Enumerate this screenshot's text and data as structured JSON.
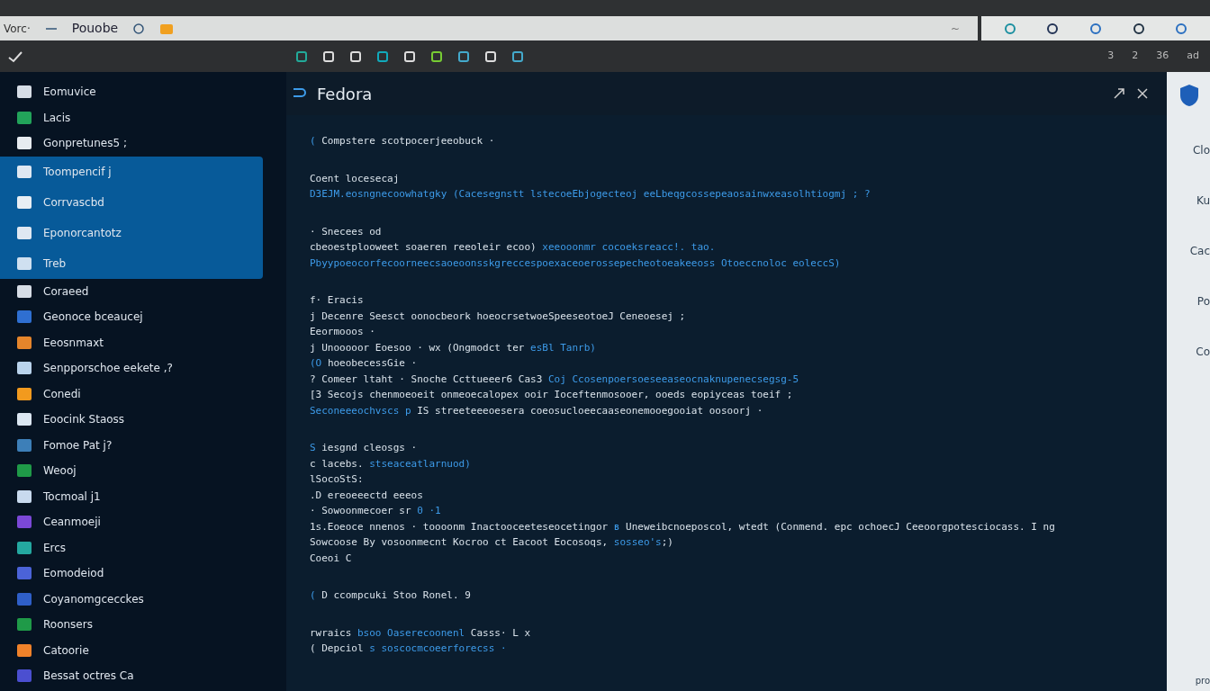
{
  "address_bar": {
    "left_text": "Vorc·",
    "title": "Pouobe",
    "right_text": "~"
  },
  "toolbar": {
    "right_items": [
      "3",
      "2",
      "36",
      "ad"
    ]
  },
  "sidebar": {
    "items": [
      {
        "label": "Eomuvice",
        "selected": false,
        "color": "#d6dde6"
      },
      {
        "label": "Lacis",
        "selected": false,
        "color": "#22a35a"
      },
      {
        "label": "Gonpretunes5 ;",
        "selected": false,
        "color": "#e6ebf0"
      },
      {
        "label": "Toompencif j",
        "selected": true,
        "color": "#dfe8f2"
      },
      {
        "label": "Corrvascbd",
        "selected": true,
        "color": "#e8eef4"
      },
      {
        "label": "Eponorcantotz",
        "selected": true,
        "color": "#dfe8f2"
      },
      {
        "label": "Treb",
        "selected": true,
        "color": "#cfe0f0"
      },
      {
        "label": "Coraeed",
        "selected": false,
        "color": "#d6dde6"
      },
      {
        "label": "Geonoce bceaucej",
        "selected": false,
        "color": "#2f6fd1"
      },
      {
        "label": "Eeosnmaxt",
        "selected": false,
        "color": "#e5852b"
      },
      {
        "label": "Senpporschoe eekete ,?",
        "selected": false,
        "color": "#b9d3ec"
      },
      {
        "label": "Conedi",
        "selected": false,
        "color": "#f29a1e"
      },
      {
        "label": "Eoocink Staoss",
        "selected": false,
        "color": "#dce7f2"
      },
      {
        "label": "Fomoe Pat j?",
        "selected": false,
        "color": "#3d7fb8"
      },
      {
        "label": "Weooj",
        "selected": false,
        "color": "#1f9a48"
      },
      {
        "label": "Tocmoal j1",
        "selected": false,
        "color": "#c8daee"
      },
      {
        "label": "Ceanmoeji",
        "selected": false,
        "color": "#7b48d6"
      },
      {
        "label": "Ercs",
        "selected": false,
        "color": "#24a8a0"
      },
      {
        "label": "Eomodeiod",
        "selected": false,
        "color": "#4b63d8"
      },
      {
        "label": "Coyanomgcecckes",
        "selected": false,
        "color": "#2f5fc8"
      },
      {
        "label": "Roonsers",
        "selected": false,
        "color": "#1f9a48"
      },
      {
        "label": "Catoorie",
        "selected": false,
        "color": "#f0822a"
      },
      {
        "label": "Bessat octres Ca",
        "selected": false,
        "color": "#4b4fd0"
      }
    ]
  },
  "editor": {
    "title": "Fedora",
    "lines": [
      {
        "section_start": false,
        "segments": [
          {
            "text": "( ",
            "highlighted": true
          },
          {
            "text": "Compstere scotpocerjeeobuck ·",
            "highlighted": false
          }
        ]
      },
      {
        "section_start": true,
        "segments": [
          {
            "text": "Coent locesecaj",
            "highlighted": false
          }
        ]
      },
      {
        "section_start": false,
        "segments": [
          {
            "text": "D3EJM.eosngnecoowhatgky (Cacesegnstt lstecoeEbjogecteoj eeLbeqgcossepeaosainwxeasolhtiogmj ; ?",
            "highlighted": true
          }
        ]
      },
      {
        "section_start": true,
        "segments": [
          {
            "text": "· Snecees od",
            "highlighted": false
          }
        ]
      },
      {
        "section_start": false,
        "segments": [
          {
            "text": "cbeoestplooweet soaeren reeoleir ecoo) ",
            "highlighted": false
          },
          {
            "text": "xeeooonmr cocoeksreacc!. tao.",
            "highlighted": true
          }
        ]
      },
      {
        "section_start": false,
        "segments": [
          {
            "text": "Pbyypoeocorfecoorneecsaoeoonsskgreccespoexaceoerossepecheotoeakeeoss Otoeccnoloc eoleccS)",
            "highlighted": true
          }
        ]
      },
      {
        "section_start": true,
        "segments": [
          {
            "text": "f· Eracis",
            "highlighted": false
          }
        ]
      },
      {
        "section_start": false,
        "segments": [
          {
            "text": "j Decenre Seesct oonocbeork hoeocrsetwoeSpeeseotoeJ Ceneoesej ;",
            "highlighted": false
          }
        ]
      },
      {
        "section_start": false,
        "segments": [
          {
            "text": "Eeormooos ·",
            "highlighted": false
          }
        ]
      },
      {
        "section_start": false,
        "segments": [
          {
            "text": "j Unooooor Eoesoo · wx (Ongmodct ter ",
            "highlighted": false
          },
          {
            "text": "esBl Tanrb)",
            "highlighted": true
          }
        ]
      },
      {
        "section_start": false,
        "segments": [
          {
            "text": "(O ",
            "highlighted": true
          },
          {
            "text": "hoeobecessGie ·",
            "highlighted": false
          }
        ]
      },
      {
        "section_start": false,
        "segments": [
          {
            "text": "? Comeer ltaht · Snoche Ccttueeer6 Cas3 ",
            "highlighted": false
          },
          {
            "text": "Coj Ccosenpoersoeseeaseocnaknupenecsegsg-5",
            "highlighted": true
          }
        ]
      },
      {
        "section_start": false,
        "segments": [
          {
            "text": "[3 Secojs chenmoeoeit onmeoecalopex ooir Ioceftenmosooer, ooeds eopiyceas toeif ;",
            "highlighted": false
          }
        ]
      },
      {
        "section_start": false,
        "segments": [
          {
            "text": "Seconeeeochvscs p ",
            "highlighted": true
          },
          {
            "text": "IS streeteeeoesera coeosucloeecaaseonemooegooiat oosoorj ·",
            "highlighted": false
          }
        ]
      },
      {
        "section_start": true,
        "segments": [
          {
            "text": "S ",
            "highlighted": true
          },
          {
            "text": "iesgnd cleosgs ·",
            "highlighted": false
          }
        ]
      },
      {
        "section_start": false,
        "segments": [
          {
            "text": "c lacebs. ",
            "highlighted": false
          },
          {
            "text": "stseaceatlarnuod)",
            "highlighted": true
          }
        ]
      },
      {
        "section_start": false,
        "segments": [
          {
            "text": "lSocoStS:",
            "highlighted": false
          }
        ]
      },
      {
        "section_start": false,
        "segments": [
          {
            "text": ".D ereoeeectd eeeos",
            "highlighted": false
          }
        ]
      },
      {
        "section_start": false,
        "segments": [
          {
            "text": "· Sowoonmecoer sr ",
            "highlighted": false
          },
          {
            "text": "0 ·1",
            "highlighted": true
          }
        ]
      },
      {
        "section_start": false,
        "segments": [
          {
            "text": "1s.Eoeoce nnenos · toooonm Inactooceeteseocetingor ",
            "highlighted": false
          },
          {
            "text": "ʙ",
            "highlighted": true
          },
          {
            "text": " Uneweibcnoeposcol, wtedt (Conmend. epc ochoecJ Ceeoorgpotesciocass. I ng",
            "highlighted": false
          }
        ]
      },
      {
        "section_start": false,
        "segments": [
          {
            "text": "Sowcoose By vosoonmecnt Kocroo ct Eacoot Eocosoqs, ",
            "highlighted": false
          },
          {
            "text": "sosseo's",
            "highlighted": true
          },
          {
            "text": ";)",
            "highlighted": false
          }
        ]
      },
      {
        "section_start": false,
        "segments": [
          {
            "text": "Coeoi C",
            "highlighted": false
          }
        ]
      },
      {
        "section_start": true,
        "segments": [
          {
            "text": "( ",
            "highlighted": true
          },
          {
            "text": "D ccompcuki Stoo Ronel. 9",
            "highlighted": false
          }
        ]
      },
      {
        "section_start": true,
        "segments": [
          {
            "text": "rwraics ",
            "highlighted": false
          },
          {
            "text": "bsoo Oaserecoonenl",
            "highlighted": true
          },
          {
            "text": " Casss· L x",
            "highlighted": false
          }
        ]
      },
      {
        "section_start": false,
        "segments": [
          {
            "text": "( Depciol ",
            "highlighted": false
          },
          {
            "text": "s soscocmcoeerforecss ·",
            "highlighted": true
          }
        ]
      }
    ]
  },
  "side_panel": {
    "items": [
      "Clo",
      "Ku",
      "Cac",
      "Po",
      "Co"
    ],
    "footer": "pro"
  }
}
